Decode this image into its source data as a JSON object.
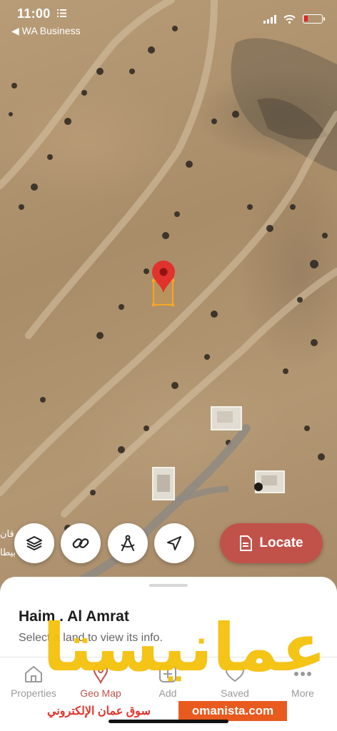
{
  "status_bar": {
    "time": "11:00",
    "back_label": "◀ WA Business"
  },
  "map": {
    "pin_color": "#e1322d",
    "plot_color": "#f5a623"
  },
  "controls": {
    "layers_icon": "layers-icon",
    "link_icon": "link-icon",
    "measure_icon": "measure-compass-icon",
    "navigate_icon": "navigation-arrow-icon",
    "locate_label": "Locate",
    "locate_color": "#c1524a"
  },
  "sheet": {
    "title": "Haim . Al Amrat",
    "subtitle": "Select a land to view its info."
  },
  "tabs": [
    {
      "label": "Properties",
      "icon": "home-icon",
      "active": false
    },
    {
      "label": "Geo Map",
      "icon": "pin-icon",
      "active": true
    },
    {
      "label": "Add",
      "icon": "plus-icon",
      "active": false
    },
    {
      "label": "Saved",
      "icon": "heart-icon",
      "active": false
    },
    {
      "label": "More",
      "icon": "dots-icon",
      "active": false
    }
  ],
  "watermark": {
    "word": "عمانيستا",
    "arabic_tagline": "سوق عمان الإلكتروني",
    "site": "omanista.com",
    "color": "#f4c20d"
  }
}
